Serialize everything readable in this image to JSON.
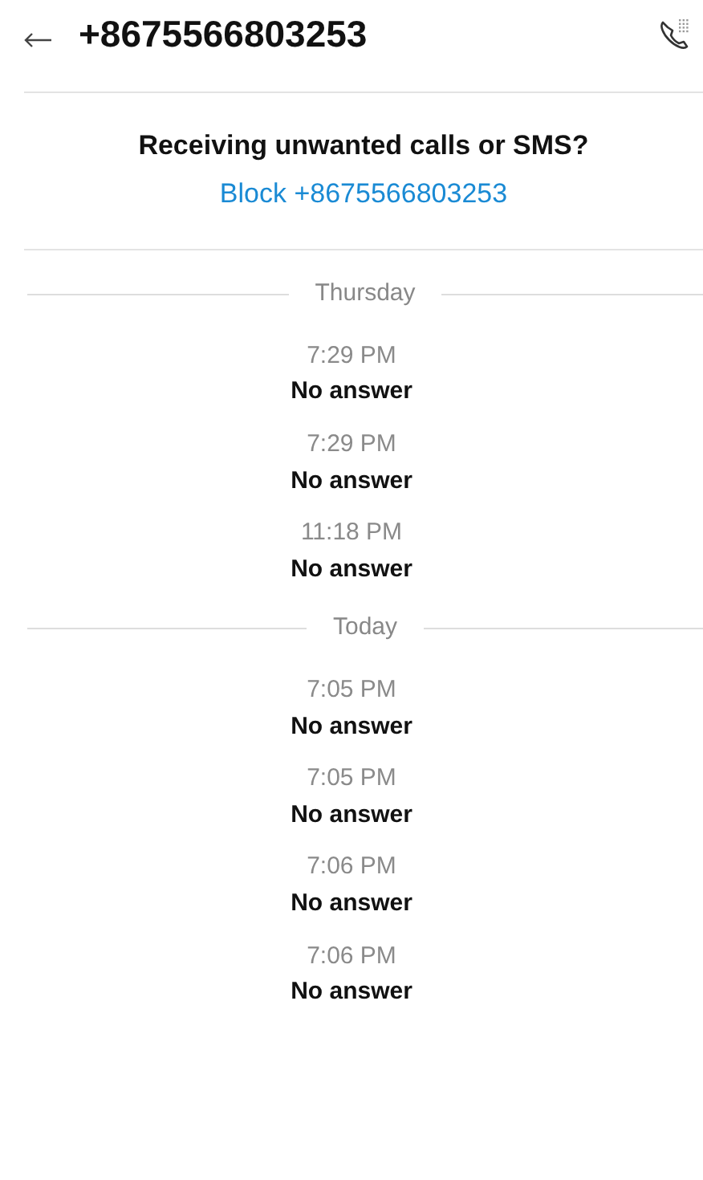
{
  "header": {
    "title": "+8675566803253"
  },
  "block_prompt": {
    "question": "Receiving unwanted calls or SMS?",
    "link": "Block +8675566803253"
  },
  "days": [
    {
      "label": "Thursday",
      "calls": [
        {
          "time": "7:29 PM",
          "status": "No answer"
        },
        {
          "time": "7:29 PM",
          "status": "No answer"
        },
        {
          "time": "11:18 PM",
          "status": "No answer"
        }
      ]
    },
    {
      "label": "Today",
      "calls": [
        {
          "time": "7:05 PM",
          "status": "No answer"
        },
        {
          "time": "7:05 PM",
          "status": "No answer"
        },
        {
          "time": "7:06 PM",
          "status": "No answer"
        },
        {
          "time": "7:06 PM",
          "status": "No answer"
        }
      ]
    }
  ]
}
